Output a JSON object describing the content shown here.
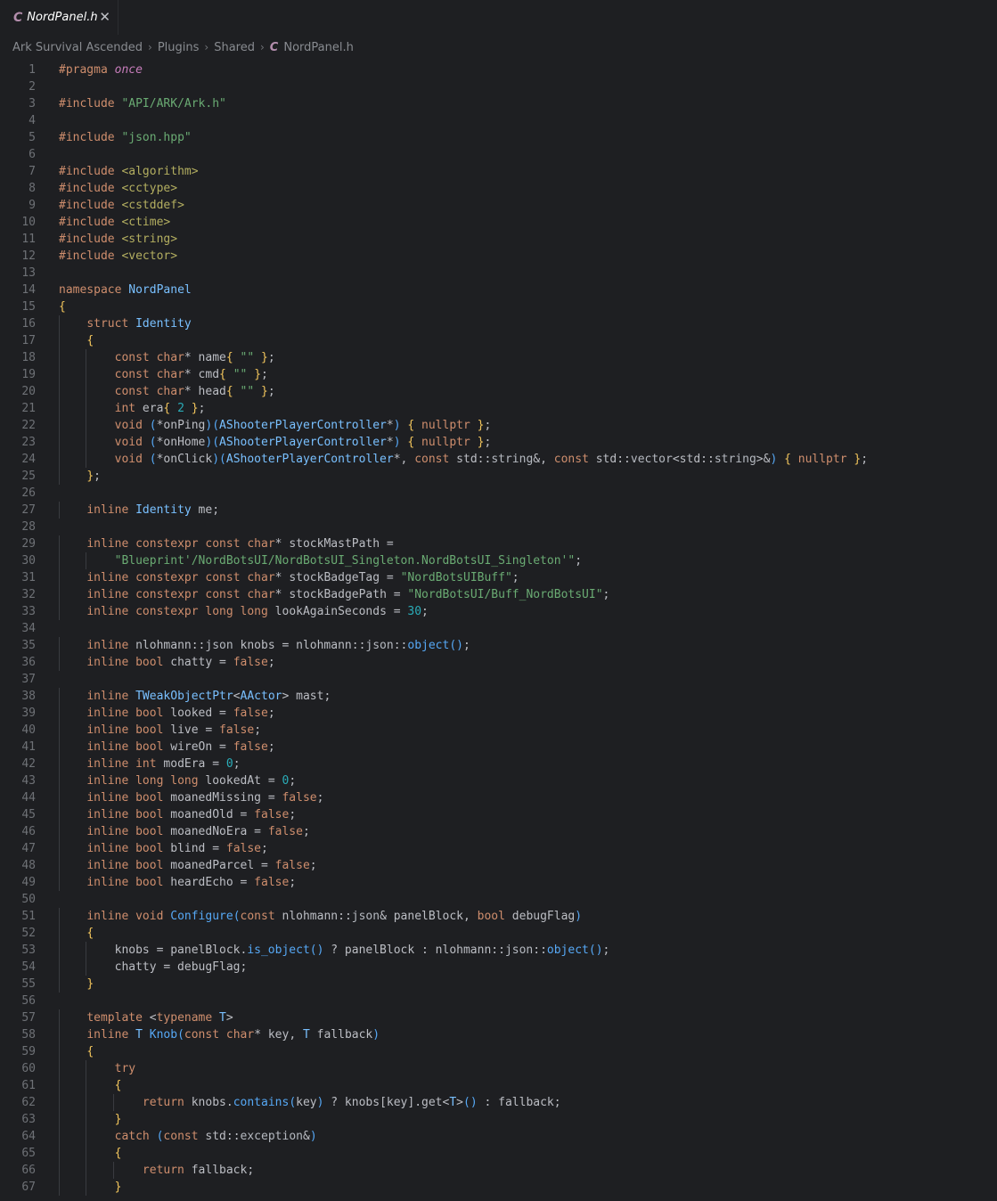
{
  "tab": {
    "file_icon": "C",
    "file_name": "NordPanel.h",
    "close": "✕"
  },
  "breadcrumb": {
    "items": [
      "Ark Survival Ascended",
      "Plugins",
      "Shared"
    ],
    "file_icon": "C",
    "file": "NordPanel.h",
    "separator": "›"
  },
  "editor": {
    "lines": [
      {
        "n": "1",
        "t": "#pragma once"
      },
      {
        "n": "2",
        "t": ""
      },
      {
        "n": "3",
        "t": "#include \"API/ARK/Ark.h\""
      },
      {
        "n": "4",
        "t": ""
      },
      {
        "n": "5",
        "t": "#include \"json.hpp\""
      },
      {
        "n": "6",
        "t": ""
      },
      {
        "n": "7",
        "t": "#include <algorithm>"
      },
      {
        "n": "8",
        "t": "#include <cctype>"
      },
      {
        "n": "9",
        "t": "#include <cstddef>"
      },
      {
        "n": "10",
        "t": "#include <ctime>"
      },
      {
        "n": "11",
        "t": "#include <string>"
      },
      {
        "n": "12",
        "t": "#include <vector>"
      },
      {
        "n": "13",
        "t": ""
      },
      {
        "n": "14",
        "t": "namespace NordPanel"
      },
      {
        "n": "15",
        "t": "{"
      },
      {
        "n": "16",
        "t": "    struct Identity"
      },
      {
        "n": "17",
        "t": "    {"
      },
      {
        "n": "18",
        "t": "        const char* name{ \"\" };"
      },
      {
        "n": "19",
        "t": "        const char* cmd{ \"\" };"
      },
      {
        "n": "20",
        "t": "        const char* head{ \"\" };"
      },
      {
        "n": "21",
        "t": "        int era{ 2 };"
      },
      {
        "n": "22",
        "t": "        void (*onPing)(AShooterPlayerController*) { nullptr };"
      },
      {
        "n": "23",
        "t": "        void (*onHome)(AShooterPlayerController*) { nullptr };"
      },
      {
        "n": "24",
        "t": "        void (*onClick)(AShooterPlayerController*, const std::string&, const std::vector<std::string>&) { nullptr };"
      },
      {
        "n": "25",
        "t": "    };"
      },
      {
        "n": "26",
        "t": ""
      },
      {
        "n": "27",
        "t": "    inline Identity me;"
      },
      {
        "n": "28",
        "t": ""
      },
      {
        "n": "29",
        "t": "    inline constexpr const char* stockMastPath ="
      },
      {
        "n": "30",
        "t": "        \"Blueprint'/NordBotsUI/NordBotsUI_Singleton.NordBotsUI_Singleton'\";"
      },
      {
        "n": "31",
        "t": "    inline constexpr const char* stockBadgeTag = \"NordBotsUIBuff\";"
      },
      {
        "n": "32",
        "t": "    inline constexpr const char* stockBadgePath = \"NordBotsUI/Buff_NordBotsUI\";"
      },
      {
        "n": "33",
        "t": "    inline constexpr long long lookAgainSeconds = 30;"
      },
      {
        "n": "34",
        "t": ""
      },
      {
        "n": "35",
        "t": "    inline nlohmann::json knobs = nlohmann::json::object();"
      },
      {
        "n": "36",
        "t": "    inline bool chatty = false;"
      },
      {
        "n": "37",
        "t": ""
      },
      {
        "n": "38",
        "t": "    inline TWeakObjectPtr<AActor> mast;"
      },
      {
        "n": "39",
        "t": "    inline bool looked = false;"
      },
      {
        "n": "40",
        "t": "    inline bool live = false;"
      },
      {
        "n": "41",
        "t": "    inline bool wireOn = false;"
      },
      {
        "n": "42",
        "t": "    inline int modEra = 0;"
      },
      {
        "n": "43",
        "t": "    inline long long lookedAt = 0;"
      },
      {
        "n": "44",
        "t": "    inline bool moanedMissing = false;"
      },
      {
        "n": "45",
        "t": "    inline bool moanedOld = false;"
      },
      {
        "n": "46",
        "t": "    inline bool moanedNoEra = false;"
      },
      {
        "n": "47",
        "t": "    inline bool blind = false;"
      },
      {
        "n": "48",
        "t": "    inline bool moanedParcel = false;"
      },
      {
        "n": "49",
        "t": "    inline bool heardEcho = false;"
      },
      {
        "n": "50",
        "t": ""
      },
      {
        "n": "51",
        "t": "    inline void Configure(const nlohmann::json& panelBlock, bool debugFlag)"
      },
      {
        "n": "52",
        "t": "    {"
      },
      {
        "n": "53",
        "t": "        knobs = panelBlock.is_object() ? panelBlock : nlohmann::json::object();"
      },
      {
        "n": "54",
        "t": "        chatty = debugFlag;"
      },
      {
        "n": "55",
        "t": "    }"
      },
      {
        "n": "56",
        "t": ""
      },
      {
        "n": "57",
        "t": "    template <typename T>"
      },
      {
        "n": "58",
        "t": "    inline T Knob(const char* key, T fallback)"
      },
      {
        "n": "59",
        "t": "    {"
      },
      {
        "n": "60",
        "t": "        try"
      },
      {
        "n": "61",
        "t": "        {"
      },
      {
        "n": "62",
        "t": "            return knobs.contains(key) ? knobs[key].get<T>() : fallback;"
      },
      {
        "n": "63",
        "t": "        }"
      },
      {
        "n": "64",
        "t": "        catch (const std::exception&)"
      },
      {
        "n": "65",
        "t": "        {"
      },
      {
        "n": "66",
        "t": "            return fallback;"
      },
      {
        "n": "67",
        "t": "        }"
      }
    ]
  }
}
